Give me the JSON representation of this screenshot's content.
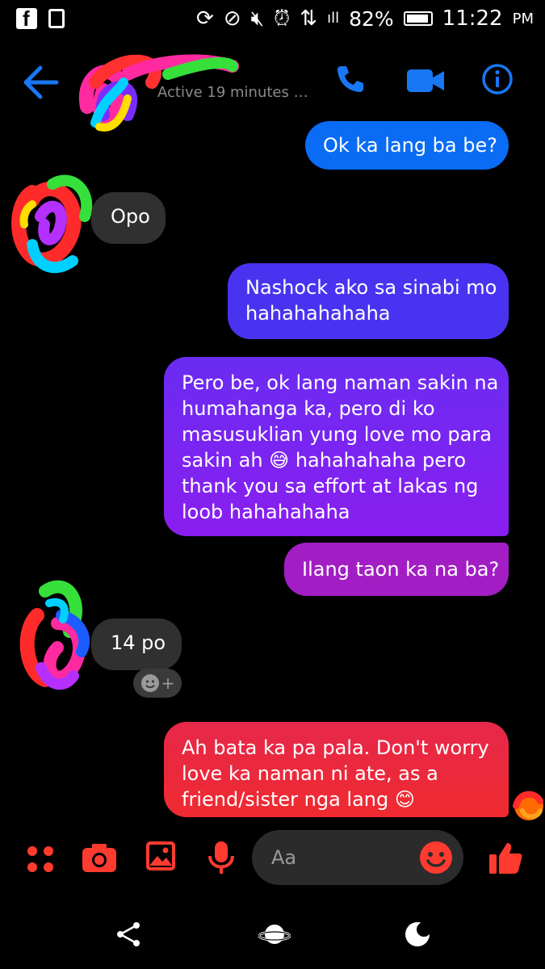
{
  "status_bar": {
    "battery_percent": "82%",
    "time": "11:22",
    "ampm": "PM",
    "icons": [
      "facebook-icon",
      "phone-icon",
      "sync-icon",
      "block-icon",
      "mute-icon",
      "alarm-icon",
      "data-icon",
      "signal-icon",
      "battery-icon"
    ]
  },
  "header": {
    "active_status": "Active 19 minutes a...",
    "accent_color": "#1877F2",
    "icons": [
      "back-arrow-icon",
      "phone-call-icon",
      "video-call-icon",
      "info-icon"
    ]
  },
  "messages": [
    {
      "side": "sent",
      "lines": [
        "Ok ka lang ba be?"
      ],
      "color": "#0a6cf5"
    },
    {
      "side": "received",
      "lines": [
        "Opo"
      ]
    },
    {
      "side": "sent",
      "lines": [
        "Nashock ako sa sinabi mo",
        "hahahahahaha"
      ],
      "color": "#4a33f0"
    },
    {
      "side": "sent",
      "lines": [
        "Pero be, ok lang naman sakin na",
        "humahanga ka, pero di ko",
        "masusuklian yung love mo para",
        "sakin ah 😅 hahahahaha pero",
        "thank you sa effort at lakas ng",
        "loob hahahahaha"
      ],
      "color": "#7a22f2"
    },
    {
      "side": "sent",
      "lines": [
        "Ilang taon ka na ba?"
      ],
      "color": "#a21ec4"
    },
    {
      "side": "received",
      "lines": [
        "14 po"
      ]
    },
    {
      "side": "sent",
      "lines": [
        "Ah bata ka pa pala. Don't worry",
        "love ka naman ni ate, as a",
        "friend/sister nga lang 😊"
      ],
      "color": "#ee2a3c"
    }
  ],
  "composer": {
    "placeholder": "Aa",
    "accent_color": "#ff3b2f",
    "icons": [
      "menu-dots-icon",
      "camera-icon",
      "gallery-icon",
      "microphone-icon",
      "emoji-icon",
      "thumbs-up-icon"
    ]
  },
  "nav_bar": {
    "icons": [
      "share-icon",
      "saturn-icon",
      "moon-toggle-icon"
    ]
  }
}
